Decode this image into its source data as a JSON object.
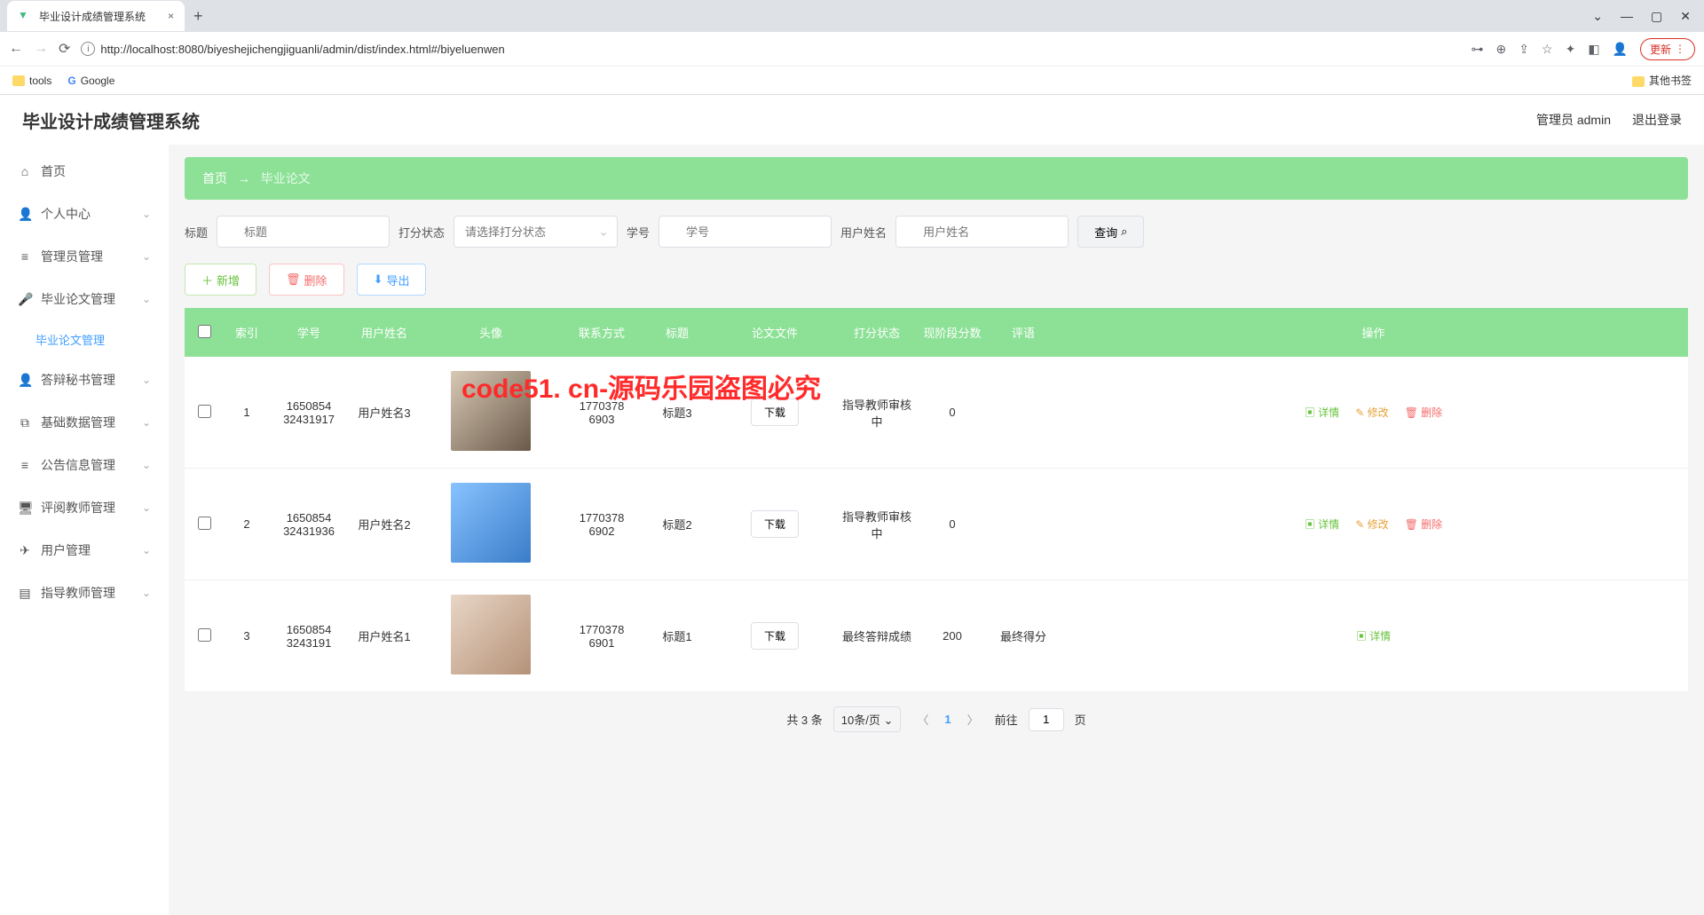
{
  "browser": {
    "tab_title": "毕业设计成绩管理系统",
    "url": "http://localhost:8080/biyeshejichengjiguanli/admin/dist/index.html#/biyeluenwen",
    "update": "更新",
    "bookmark_tools": "tools",
    "bookmark_google": "Google",
    "bookmark_other": "其他书签"
  },
  "header": {
    "title": "毕业设计成绩管理系统",
    "user": "管理员 admin",
    "logout": "退出登录"
  },
  "sidebar": {
    "items": [
      {
        "icon": "⌂",
        "label": "首页"
      },
      {
        "icon": "👤",
        "label": "个人中心",
        "chev": "⌄"
      },
      {
        "icon": "≡",
        "label": "管理员管理",
        "chev": "⌄"
      },
      {
        "icon": "🎤",
        "label": "毕业论文管理",
        "chev": "⌄"
      },
      {
        "icon": "👤",
        "label": "答辩秘书管理",
        "chev": "⌄"
      },
      {
        "icon": "⧉",
        "label": "基础数据管理",
        "chev": "⌄"
      },
      {
        "icon": "≡",
        "label": "公告信息管理",
        "chev": "⌄"
      },
      {
        "icon": "🖥",
        "label": "评阅教师管理",
        "chev": "⌄"
      },
      {
        "icon": "✈",
        "label": "用户管理",
        "chev": "⌄"
      },
      {
        "icon": "▤",
        "label": "指导教师管理",
        "chev": "⌄"
      }
    ],
    "sub_active": "毕业论文管理"
  },
  "breadcrumb": {
    "home": "首页",
    "sep": "→",
    "current": "毕业论文"
  },
  "search": {
    "title_label": "标题",
    "title_ph": "标题",
    "status_label": "打分状态",
    "status_ph": "请选择打分状态",
    "sid_label": "学号",
    "sid_ph": "学号",
    "uname_label": "用户姓名",
    "uname_ph": "用户姓名",
    "query": "查询"
  },
  "actions": {
    "add": "新增",
    "delete": "删除",
    "export": "导出"
  },
  "table": {
    "headers": [
      "",
      "索引",
      "学号",
      "用户姓名",
      "头像",
      "联系方式",
      "标题",
      "论文文件",
      "打分状态",
      "现阶段分数",
      "评语",
      "操作"
    ],
    "download": "下载",
    "detail": "详情",
    "edit": "修改",
    "del": "删除",
    "rows": [
      {
        "idx": "1",
        "sid": "1650854 32431917",
        "uname": "用户姓名3",
        "contact": "1770378 6903",
        "title": "标题3",
        "status": "指导教师审核中",
        "score": "0",
        "comment": ""
      },
      {
        "idx": "2",
        "sid": "1650854 32431936",
        "uname": "用户姓名2",
        "contact": "1770378 6902",
        "title": "标题2",
        "status": "指导教师审核中",
        "score": "0",
        "comment": ""
      },
      {
        "idx": "3",
        "sid": "1650854 3243191",
        "uname": "用户姓名1",
        "contact": "1770378 6901",
        "title": "标题1",
        "status": "最终答辩成绩",
        "score": "200",
        "comment": "最终得分"
      }
    ]
  },
  "pagination": {
    "total": "共 3 条",
    "per": "10条/页",
    "page": "1",
    "goto": "前往",
    "goto_val": "1",
    "page_unit": "页"
  },
  "overlay": "code51. cn-源码乐园盗图必究"
}
